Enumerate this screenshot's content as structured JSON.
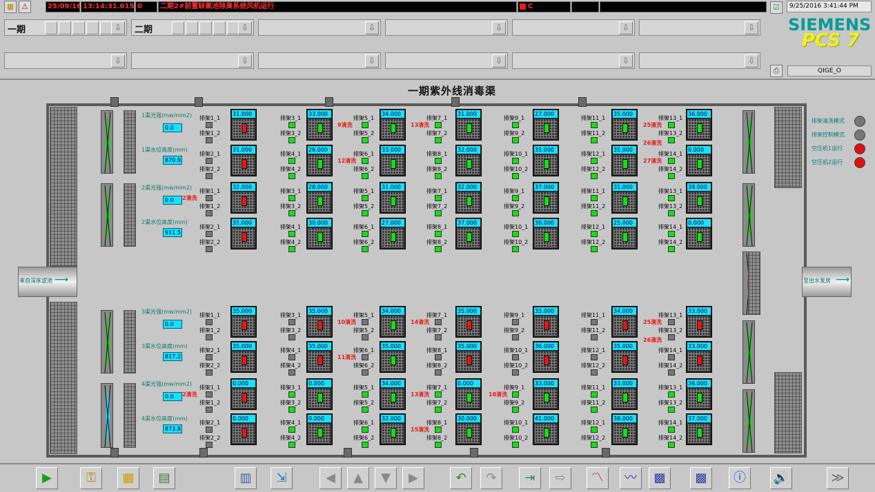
{
  "header": {
    "alarm_date": "25/09/16",
    "alarm_time": "13:14:31.615",
    "alarm_num": "0",
    "alarm_text": "二期2#前置缺氧池除臭系统风机运行",
    "alarm_ack": "C",
    "clock": "9/25/2016 3:41:44 PM",
    "user": "QIGE_O",
    "brand_top": "SIEMENS",
    "brand_bottom": "PCS 7",
    "area1": "一期",
    "area2": "二期"
  },
  "title": "一期紫外线消毒渠",
  "inlet": "来自深床滤池",
  "outlet": "至出水泵房",
  "legend": [
    {
      "label": "排架清洗模式",
      "color": "#777777"
    },
    {
      "label": "排架控制模式",
      "color": "#777777"
    },
    {
      "label": "空压机1运行",
      "color": "#e01010"
    },
    {
      "label": "空压机2运行",
      "color": "#e01010"
    }
  ],
  "channels": [
    {
      "light_label": "1渠光强(mw/mm2)",
      "light_val": "0.0",
      "level_label": "1渠水位高度(mm)",
      "level_val": "870.9"
    },
    {
      "light_label": "2渠光强(mw/mm2)",
      "light_val": "0.0",
      "level_label": "2渠水位高度(mm)",
      "level_val": "911.5"
    },
    {
      "light_label": "3渠光强(mw/mm2)",
      "light_val": "0.0",
      "level_label": "3渠水位高度(mm)",
      "level_val": "817.2"
    },
    {
      "light_label": "4渠光强(mw/mm2)",
      "light_val": "0.0",
      "level_label": "4渠水位高度(mm)",
      "level_val": "873.8"
    }
  ],
  "rows": [
    {
      "units": [
        {
          "v": "31.000",
          "s": "R"
        },
        {
          "v": "33.000",
          "s": "G"
        },
        {
          "v": "34.000",
          "s": "G"
        },
        {
          "v": "31.000",
          "s": "G"
        },
        {
          "v": "27.000",
          "s": "G"
        },
        {
          "v": "35.000",
          "s": "G"
        },
        {
          "v": "36.000",
          "s": "G"
        }
      ],
      "names": [
        "排架1_1",
        "排架3_1",
        "排架5_1",
        "排架7_1",
        "排架9_1",
        "排架11_1",
        "排架13_1"
      ],
      "names2": [
        "排架1_2",
        "排架3_2",
        "排架5_2",
        "排架7_2",
        "排架9_2",
        "排架11_2",
        "排架13_2"
      ],
      "sq1": [
        "gy",
        "gr",
        "gr",
        "gr",
        "gr",
        "gr",
        "gr"
      ],
      "sq2": [
        "gy",
        "gr",
        "gr",
        "gr",
        "gr",
        "gr",
        "gr"
      ],
      "washes": [
        {
          "t": "9清洗",
          "c": 2
        },
        {
          "t": "13清洗",
          "c": 3
        },
        {
          "t": "25清洗",
          "c": 6
        },
        {
          "t": "26清洗",
          "c": 6
        }
      ]
    },
    {
      "units": [
        {
          "v": "31.000",
          "s": "R"
        },
        {
          "v": "26.000",
          "s": "G"
        },
        {
          "v": "33.000",
          "s": "G"
        },
        {
          "v": "32.000",
          "s": "G"
        },
        {
          "v": "35.000",
          "s": "G"
        },
        {
          "v": "35.000",
          "s": "G"
        },
        {
          "v": "0.000",
          "s": "G"
        }
      ],
      "names": [
        "排架2_1",
        "排架4_1",
        "排架6_1",
        "排架8_1",
        "排架10_1",
        "排架12_1",
        "排架14_1"
      ],
      "names2": [
        "排架2_2",
        "排架4_2",
        "排架6_2",
        "排架8_2",
        "排架10_2",
        "排架12_2",
        "排架14_2"
      ],
      "sq1": [
        "gy",
        "gr",
        "gr",
        "gr",
        "gr",
        "gr",
        "gr"
      ],
      "sq2": [
        "gy",
        "gr",
        "gr",
        "gr",
        "gr",
        "gr",
        "gr"
      ],
      "washes": [
        {
          "t": "12清洗",
          "c": 2
        },
        {
          "t": "27清洗",
          "c": 6
        }
      ]
    },
    {
      "units": [
        {
          "v": "32.000",
          "s": "R"
        },
        {
          "v": "28.000",
          "s": "G"
        },
        {
          "v": "31.000",
          "s": "G"
        },
        {
          "v": "32.000",
          "s": "G"
        },
        {
          "v": "37.000",
          "s": "G"
        },
        {
          "v": "31.000",
          "s": "G"
        },
        {
          "v": "39.000",
          "s": "G"
        }
      ],
      "names": [
        "排架1_1",
        "排架3_1",
        "排架5_1",
        "排架7_1",
        "排架9_1",
        "排架11_1",
        "排架13_1"
      ],
      "names2": [
        "排架1_2",
        "排架3_2",
        "排架5_2",
        "排架7_2",
        "排架9_2",
        "排架11_2",
        "排架13_2"
      ],
      "sq1": [
        "gy",
        "gr",
        "gr",
        "gr",
        "gr",
        "gr",
        "gr"
      ],
      "sq2": [
        "gy",
        "gr",
        "gr",
        "gr",
        "gr",
        "gr",
        "gr"
      ],
      "washes": [
        {
          "t": "2清洗",
          "c": 0
        }
      ]
    },
    {
      "units": [
        {
          "v": "31.000",
          "s": "R"
        },
        {
          "v": "30.000",
          "s": "G"
        },
        {
          "v": "27.000",
          "s": "G"
        },
        {
          "v": "37.000",
          "s": "G"
        },
        {
          "v": "30.000",
          "s": "G"
        },
        {
          "v": "25.000",
          "s": "G"
        },
        {
          "v": "0.000",
          "s": "G"
        }
      ],
      "names": [
        "排架2_1",
        "排架4_1",
        "排架6_1",
        "排架8_1",
        "排架10_1",
        "排架12_1",
        "排架14_1"
      ],
      "names2": [
        "排架2_2",
        "排架4_2",
        "排架6_2",
        "排架8_2",
        "排架10_2",
        "排架12_2",
        "排架14_2"
      ],
      "sq1": [
        "gy",
        "gr",
        "gr",
        "gr",
        "gr",
        "gr",
        "gr"
      ],
      "sq2": [
        "gy",
        "gr",
        "gr",
        "gr",
        "gr",
        "gr",
        "gr"
      ],
      "washes": []
    },
    {
      "units": [
        {
          "v": "35.000",
          "s": "R"
        },
        {
          "v": "35.000",
          "s": "R"
        },
        {
          "v": "34.000",
          "s": "G"
        },
        {
          "v": "35.000",
          "s": "R"
        },
        {
          "v": "35.000",
          "s": "R"
        },
        {
          "v": "34.000",
          "s": "R"
        },
        {
          "v": "33.000",
          "s": "R"
        }
      ],
      "names": [
        "排架1_1",
        "排架3_1",
        "排架5_1",
        "排架7_1",
        "排架9_1",
        "排架11_1",
        "排架13_1"
      ],
      "names2": [
        "排架1_2",
        "排架3_2",
        "排架5_2",
        "排架7_2",
        "排架9_2",
        "排架11_2",
        "排架13_2"
      ],
      "sq1": [
        "gy",
        "gy",
        "gy",
        "gy",
        "gy",
        "gy",
        "gy"
      ],
      "sq2": [
        "gy",
        "gy",
        "gy",
        "gy",
        "gy",
        "gy",
        "gy"
      ],
      "washes": [
        {
          "t": "10清洗",
          "c": 2
        },
        {
          "t": "14清洗",
          "c": 3
        },
        {
          "t": "25清洗",
          "c": 6
        },
        {
          "t": "26清洗",
          "c": 6
        }
      ]
    },
    {
      "units": [
        {
          "v": "35.000",
          "s": "R"
        },
        {
          "v": "35.000",
          "s": "R"
        },
        {
          "v": "35.000",
          "s": "G"
        },
        {
          "v": "35.000",
          "s": "R"
        },
        {
          "v": "36.000",
          "s": "R"
        },
        {
          "v": "35.000",
          "s": "R"
        },
        {
          "v": "33.000",
          "s": "R"
        }
      ],
      "names": [
        "排架2_1",
        "排架4_1",
        "排架6_1",
        "排架8_1",
        "排架10_1",
        "排架12_1",
        "排架14_1"
      ],
      "names2": [
        "排架2_2",
        "排架4_2",
        "排架6_2",
        "排架8_2",
        "排架10_2",
        "排架12_2",
        "排架14_2"
      ],
      "sq1": [
        "gy",
        "gy",
        "gy",
        "gy",
        "gy",
        "gy",
        "gy"
      ],
      "sq2": [
        "gy",
        "gy",
        "gy",
        "gy",
        "gy",
        "gy",
        "gy"
      ],
      "washes": [
        {
          "t": "11清洗",
          "c": 2
        }
      ]
    },
    {
      "units": [
        {
          "v": "0.000",
          "s": "R"
        },
        {
          "v": "0.000",
          "s": "G"
        },
        {
          "v": "34.000",
          "s": "G"
        },
        {
          "v": "0.000",
          "s": "G"
        },
        {
          "v": "33.000",
          "s": "G"
        },
        {
          "v": "33.000",
          "s": "G"
        },
        {
          "v": "36.000",
          "s": "G"
        }
      ],
      "names": [
        "排架1_1",
        "排架3_1",
        "排架5_1",
        "排架7_1",
        "排架9_1",
        "排架11_1",
        "排架13_1"
      ],
      "names2": [
        "排架1_2",
        "排架3_2",
        "排架5_2",
        "排架7_2",
        "排架9_2",
        "排架11_2",
        "排架13_2"
      ],
      "sq1": [
        "gy",
        "gr",
        "gr",
        "gr",
        "gr",
        "gr",
        "gr"
      ],
      "sq2": [
        "gy",
        "gr",
        "gr",
        "gr",
        "gr",
        "gr",
        "gr"
      ],
      "washes": [
        {
          "t": "2清洗",
          "c": 0
        },
        {
          "t": "13清洗",
          "c": 3
        },
        {
          "t": "18清洗",
          "c": 4
        }
      ]
    },
    {
      "units": [
        {
          "v": "0.000",
          "s": "R"
        },
        {
          "v": "0.000",
          "s": "G"
        },
        {
          "v": "32.000",
          "s": "G"
        },
        {
          "v": "30.000",
          "s": "G"
        },
        {
          "v": "41.000",
          "s": "G"
        },
        {
          "v": "38.000",
          "s": "G"
        },
        {
          "v": "37.000",
          "s": "G"
        }
      ],
      "names": [
        "排架2_1",
        "排架4_1",
        "排架6_1",
        "排架8_1",
        "排架10_1",
        "排架12_1",
        "排架14_1"
      ],
      "names2": [
        "排架2_2",
        "排架4_2",
        "排架6_2",
        "排架8_2",
        "排架10_2",
        "排架12_2",
        "排架14_2"
      ],
      "sq1": [
        "gy",
        "gr",
        "gr",
        "gr",
        "gr",
        "gr",
        "gr"
      ],
      "sq2": [
        "gy",
        "gr",
        "gr",
        "gr",
        "gr",
        "gr",
        "gr"
      ],
      "washes": [
        {
          "t": "15清洗",
          "c": 3
        }
      ]
    }
  ],
  "toolbar": [
    {
      "name": "run-button",
      "icon": "▶",
      "color": "#1aa01a"
    },
    {
      "name": "keys-button",
      "icon": "⚿",
      "color": "#b58a00"
    },
    {
      "name": "overview-button",
      "icon": "▦",
      "color": "#c9a000"
    },
    {
      "name": "area-tree-button",
      "icon": "▤",
      "color": "#3a7a3a"
    },
    {
      "name": "process-picture-button",
      "icon": "▥",
      "color": "#4060a0"
    },
    {
      "name": "picture-export-button",
      "icon": "⇲",
      "color": "#2a7ab0"
    },
    {
      "name": "nav-left-button",
      "icon": "◀",
      "color": "#8a8a8a"
    },
    {
      "name": "nav-up-button",
      "icon": "▲",
      "color": "#8a8a8a"
    },
    {
      "name": "nav-down-button",
      "icon": "▼",
      "color": "#8a8a8a"
    },
    {
      "name": "nav-right-button",
      "icon": "▶",
      "color": "#8a8a8a"
    },
    {
      "name": "undo-button",
      "icon": "↶",
      "color": "#2a8a2a"
    },
    {
      "name": "redo-button",
      "icon": "↷",
      "color": "#8a8a8a"
    },
    {
      "name": "export-button",
      "icon": "⇥",
      "color": "#2a8a6a"
    },
    {
      "name": "import-button",
      "icon": "⇨",
      "color": "#8a8a8a"
    },
    {
      "name": "trend-button",
      "icon": "〽",
      "color": "#c02020"
    },
    {
      "name": "trend2-button",
      "icon": "〰",
      "color": "#2040c0"
    },
    {
      "name": "faceplate-button",
      "icon": "▩",
      "color": "#3040a0"
    },
    {
      "name": "faceplate2-button",
      "icon": "▩",
      "color": "#3040a0"
    },
    {
      "name": "info-button",
      "icon": "ⓘ",
      "color": "#2050c0"
    },
    {
      "name": "horn-button",
      "icon": "🔊",
      "color": "#c09000"
    },
    {
      "name": "acknowledge-button",
      "icon": "≫",
      "color": "#6a6a6a"
    }
  ]
}
